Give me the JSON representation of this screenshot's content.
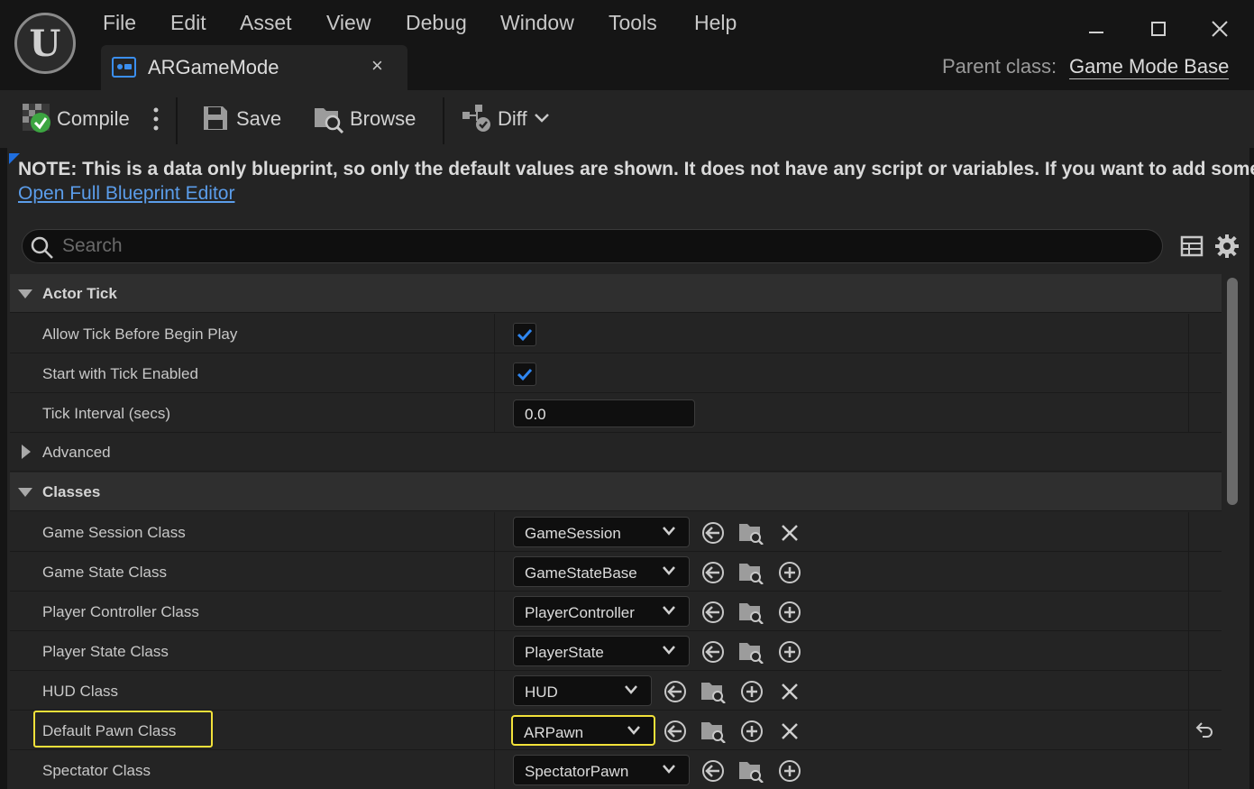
{
  "menu": [
    "File",
    "Edit",
    "Asset",
    "View",
    "Debug",
    "Window",
    "Tools",
    "Help"
  ],
  "tab": {
    "title": "ARGameMode",
    "close": "×"
  },
  "parent": {
    "label": "Parent class:",
    "value": "Game Mode Base"
  },
  "toolbar": {
    "compile": "Compile",
    "save": "Save",
    "browse": "Browse",
    "diff": "Diff"
  },
  "note": {
    "text": "NOTE: This is a data only blueprint, so only the default values are shown.  It does not have any script or variables.  If you want to add some,",
    "link": "Open Full Blueprint Editor"
  },
  "search": {
    "placeholder": "Search"
  },
  "categories": {
    "actor_tick": "Actor Tick",
    "advanced": "Advanced",
    "classes": "Classes"
  },
  "actor_tick": {
    "allow_tick": {
      "label": "Allow Tick Before Begin Play",
      "checked": true
    },
    "start_tick": {
      "label": "Start with Tick Enabled",
      "checked": true
    },
    "interval": {
      "label": "Tick Interval (secs)",
      "value": "0.0"
    }
  },
  "classes": [
    {
      "label": "Game Session Class",
      "value": "GameSession"
    },
    {
      "label": "Game State Class",
      "value": "GameStateBase"
    },
    {
      "label": "Player Controller Class",
      "value": "PlayerController"
    },
    {
      "label": "Player State Class",
      "value": "PlayerState"
    },
    {
      "label": "HUD Class",
      "value": "HUD"
    },
    {
      "label": "Default Pawn Class",
      "value": "ARPawn"
    },
    {
      "label": "Spectator Class",
      "value": "SpectatorPawn"
    }
  ],
  "colors": {
    "accent": "#1f6fe0",
    "highlight": "#f2e13a",
    "link": "#5b9dea",
    "panel": "#242424",
    "check": "#2f86f0"
  }
}
